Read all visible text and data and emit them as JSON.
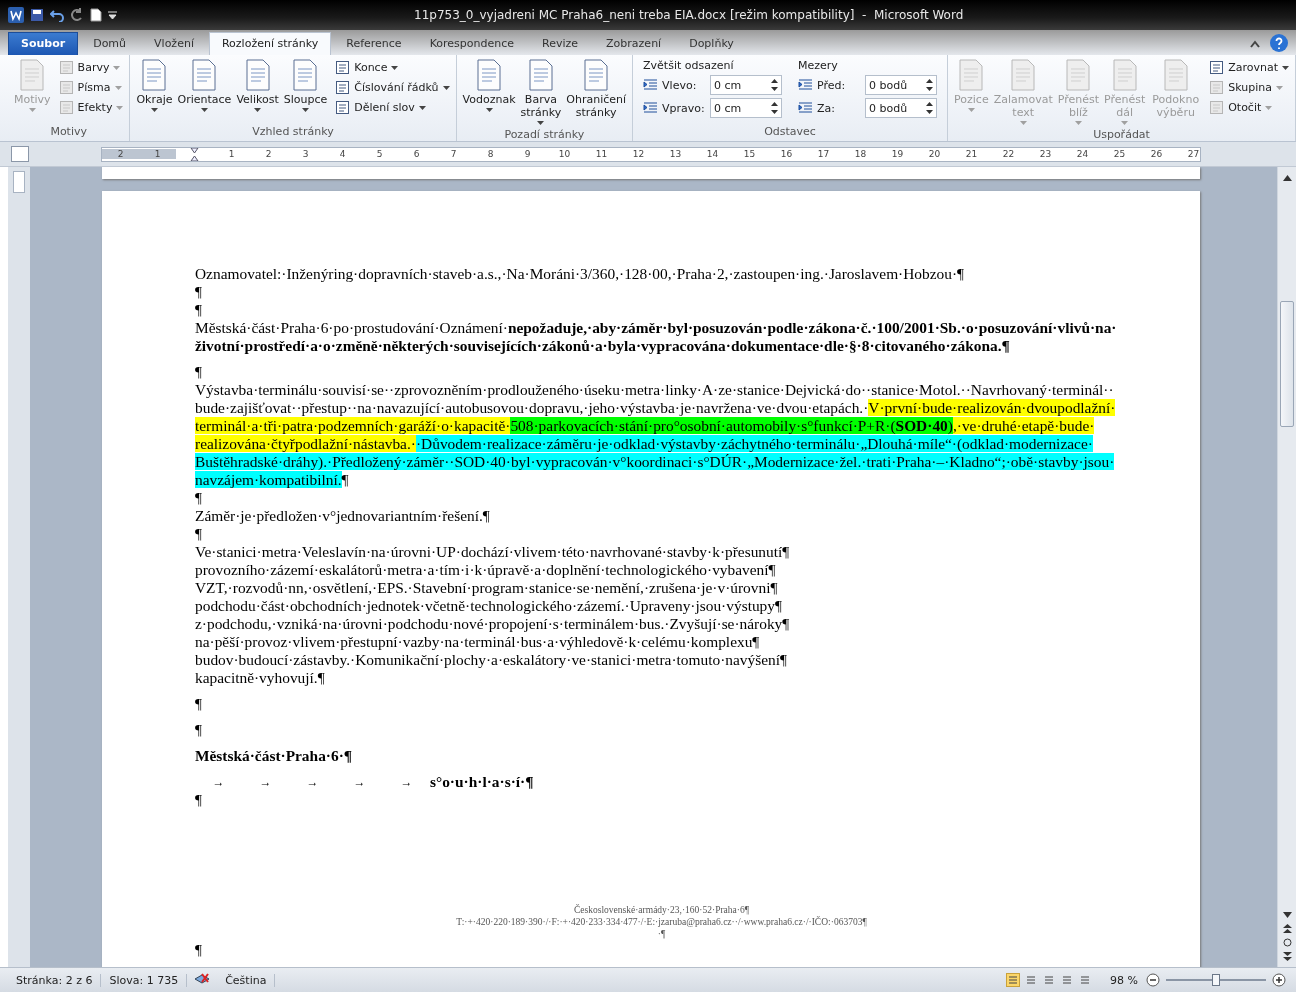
{
  "window": {
    "title": "11p753_0_vyjadreni MC Praha6_neni treba EIA.docx [režim kompatibility]  -  Microsoft Word"
  },
  "tabs": [
    {
      "label": "Soubor",
      "kind": "file",
      "selected": false
    },
    {
      "label": "Domů",
      "kind": "tab",
      "selected": false
    },
    {
      "label": "Vložení",
      "kind": "tab",
      "selected": false
    },
    {
      "label": "Rozložení stránky",
      "kind": "tab",
      "selected": true
    },
    {
      "label": "Reference",
      "kind": "tab",
      "selected": false
    },
    {
      "label": "Korespondence",
      "kind": "tab",
      "selected": false
    },
    {
      "label": "Revize",
      "kind": "tab",
      "selected": false
    },
    {
      "label": "Zobrazení",
      "kind": "tab",
      "selected": false
    },
    {
      "label": "Doplňky",
      "kind": "tab",
      "selected": false
    }
  ],
  "ribbon": [
    {
      "label": "Motivy",
      "sections": [
        {
          "kind": "big",
          "items": [
            {
              "label": "Motivy",
              "disabled": true,
              "dropdown": true
            }
          ]
        },
        {
          "kind": "stack",
          "items": [
            {
              "label": "Barvy",
              "disabled": true,
              "dropdown": true
            },
            {
              "label": "Písma",
              "disabled": true,
              "dropdown": true
            },
            {
              "label": "Efekty",
              "disabled": true,
              "dropdown": true
            }
          ]
        }
      ]
    },
    {
      "label": "Vzhled stránky",
      "sections": [
        {
          "kind": "big",
          "items": [
            {
              "label": "Okraje",
              "disabled": false,
              "dropdown": true
            },
            {
              "label": "Orientace",
              "disabled": false,
              "dropdown": true
            },
            {
              "label": "Velikost",
              "disabled": false,
              "dropdown": true
            },
            {
              "label": "Sloupce",
              "disabled": false,
              "dropdown": true
            }
          ]
        },
        {
          "kind": "stack",
          "items": [
            {
              "label": "Konce",
              "disabled": false,
              "dropdown": true
            },
            {
              "label": "Číslování řádků",
              "disabled": false,
              "dropdown": true
            },
            {
              "label": "Dělení slov",
              "disabled": false,
              "dropdown": true
            }
          ]
        }
      ]
    },
    {
      "label": "Pozadí stránky",
      "sections": [
        {
          "kind": "big",
          "items": [
            {
              "label": "Vodoznak",
              "disabled": false,
              "dropdown": true
            },
            {
              "label": "Barva stránky",
              "disabled": false,
              "dropdown": true
            },
            {
              "label": "Ohraničení stránky",
              "disabled": false,
              "dropdown": false
            }
          ]
        }
      ]
    },
    {
      "label": "Odstavec",
      "sections": [
        {
          "kind": "fields",
          "title": "Zvětšit odsazení",
          "rows": [
            {
              "label": "Vlevo:",
              "value": "0 cm"
            },
            {
              "label": "Vpravo:",
              "value": "0 cm"
            }
          ]
        },
        {
          "kind": "fields",
          "title": "Mezery",
          "rows": [
            {
              "label": "Před:",
              "value": "0 bodů"
            },
            {
              "label": "Za:",
              "value": "0 bodů"
            }
          ]
        }
      ]
    },
    {
      "label": "Uspořádat",
      "sections": [
        {
          "kind": "big",
          "items": [
            {
              "label": "Pozice",
              "disabled": true,
              "dropdown": true
            },
            {
              "label": "Zalamovat text",
              "disabled": true,
              "dropdown": true
            },
            {
              "label": "Přenést blíž",
              "disabled": true,
              "dropdown": true
            },
            {
              "label": "Přenést dál",
              "disabled": true,
              "dropdown": true
            },
            {
              "label": "Podokno výběru",
              "disabled": true,
              "dropdown": false
            }
          ]
        },
        {
          "kind": "stack",
          "items": [
            {
              "label": "Zarovnat",
              "disabled": false,
              "dropdown": true
            },
            {
              "label": "Skupina",
              "disabled": true,
              "dropdown": true
            },
            {
              "label": "Otočit",
              "disabled": true,
              "dropdown": true
            }
          ]
        }
      ]
    }
  ],
  "ruler": {
    "left_labels": [
      "2",
      "1"
    ],
    "labels": [
      "1",
      "2",
      "3",
      "4",
      "5",
      "6",
      "7",
      "8",
      "9",
      "10",
      "11",
      "12",
      "13",
      "14",
      "15",
      "16",
      "17",
      "18",
      "19",
      "20",
      "21",
      "22",
      "23",
      "24",
      "25",
      "26",
      "27"
    ]
  },
  "document": [
    {
      "kind": "para",
      "runs": [
        {
          "text": "Oznamovatel:·Inženýring·dopravních·staveb·a.s.,·Na·Moráni·3/360,·128·00,·Praha·2,·zastoupen·ing.·Jaroslavem·Hobzou·¶"
        }
      ]
    },
    {
      "kind": "para",
      "runs": [
        {
          "text": "¶"
        }
      ]
    },
    {
      "kind": "para",
      "runs": [
        {
          "text": "¶"
        }
      ]
    },
    {
      "kind": "para",
      "runs": [
        {
          "text": "Městská·část·Praha·6·po·prostudování·Oznámení·**nepožaduje,·aby·záměr·byl·posuzován·podle·zákona·č.·100/2001·Sb.·o·posuzování·vlivů·na·životní·prostředí·a·o·změně·některých·souvisejících·zákonů·a·byla·vypracována·dokumentace·dle·§·8·citovaného·zákona.¶**"
        }
      ]
    },
    {
      "kind": "spaced",
      "runs": [
        {
          "text": "¶"
        }
      ]
    },
    {
      "kind": "para",
      "runs": [
        {
          "text": "Výstavba·terminálu·souvisí·se··zprovozněním·prodlouženého·úseku·metra·linky·A·ze·stanice·Dejvická·do··stanice·Motol.··Navrhovaný·terminál··bude·zajišťovat··přestup··na·navazující·autobusovou·dopravu,·jeho·výstavba·je·navržena·ve·dvou·etapách.·"
        },
        {
          "text": "V·první·bude·realizován·dvoupodlažní·terminál·a·tři·patra·podzemních·garáží·o·kapacitě·",
          "color": "#ffff00"
        },
        {
          "text": "508·parkovacích·stání·pro°osobní·automobily·s°funkcí·P+R·(**SOD·40**)",
          "color": "#00ff00"
        },
        {
          "text": ",·ve·druhé·etapě·bude·",
          "color": "#ffff00"
        },
        {
          "text": "realizována·čtyřpodlažní·nástavba.·",
          "color": "#ffff00"
        },
        {
          "text": "·Důvodem·realizace·záměru·je·odklad·výstavby·záchytného·terminálu·„Dlouhá·míle“·(odklad·modernizace·Buštěhradské·dráhy).·Předložený·záměr··SOD·40·byl·vypracován·v°koordinaci·s°DÚR·„Modernizace·žel.·trati·Praha·–·Kladno“;·obě·stavby·jsou·navzájem·kompatibilní.",
          "color": "#00ffff"
        },
        {
          "text": "¶"
        }
      ]
    },
    {
      "kind": "para",
      "runs": [
        {
          "text": "¶"
        }
      ]
    },
    {
      "kind": "para",
      "runs": [
        {
          "text": "Záměr·je·předložen·v°jednovariantním·řešení.¶"
        }
      ]
    },
    {
      "kind": "para",
      "runs": [
        {
          "text": "¶"
        }
      ]
    },
    {
      "kind": "line",
      "runs": [
        {
          "text": "Ve·stanici·metra·Veleslavín·na·úrovni·UP·dochází·vlivem·této·navrhované·stavby·k·přesunutí¶"
        }
      ]
    },
    {
      "kind": "line",
      "runs": [
        {
          "text": "provozního·zázemí·eskalátorů·metra·a·tím·i·k·úpravě·a·doplnění·technologického·vybavení¶"
        }
      ]
    },
    {
      "kind": "line",
      "runs": [
        {
          "text": "VZT,·rozvodů·nn,·osvětlení,·EPS.·Stavební·program·stanice·se·nemění,·zrušena·je·v·úrovni¶"
        }
      ]
    },
    {
      "kind": "line",
      "runs": [
        {
          "text": "podchodu·část·obchodních·jednotek·včetně·technologického·zázemí.·Upraveny·jsou·výstupy¶"
        }
      ]
    },
    {
      "kind": "line",
      "runs": [
        {
          "text": "z·podchodu,·vzniká·na·úrovni·podchodu·nové·propojení·s·terminálem·bus.·Zvyšují·se·nároky¶"
        }
      ]
    },
    {
      "kind": "line",
      "runs": [
        {
          "text": "na·pěší·provoz·vlivem·přestupní·vazby·na·terminál·bus·a·výhledově·k·celému·komplexu¶"
        }
      ]
    },
    {
      "kind": "line",
      "runs": [
        {
          "text": "budov·budoucí·zástavby.·Komunikační·plochy·a·eskalátory·ve·stanici·metra·tomuto·navýšení¶"
        }
      ]
    },
    {
      "kind": "line",
      "runs": [
        {
          "text": "kapacitně·vyhovují.¶"
        }
      ]
    },
    {
      "kind": "spaced",
      "runs": [
        {
          "text": "¶"
        }
      ]
    },
    {
      "kind": "spaced",
      "runs": [
        {
          "text": "¶"
        }
      ]
    },
    {
      "kind": "heading",
      "runs": [
        {
          "text": "Městská·část·Praha·6·¶"
        }
      ]
    },
    {
      "kind": "tabbed",
      "tabs": [
        "→",
        "→",
        "→",
        "→",
        "→"
      ],
      "runs": [
        {
          "text": "s°o·u·h·l·a·s·í·¶"
        }
      ]
    },
    {
      "kind": "para",
      "runs": [
        {
          "text": "¶"
        }
      ]
    }
  ],
  "footer": [
    "Československé·armády·23,·160·52·Praha·6¶",
    "T:·+·420·220·189·390·/·F:·+·420·233·334·477·/·E:·jzaruba@praha6.cz··/·www.praha6.cz·/·IČO:·063703¶",
    "·¶"
  ],
  "next_paragraph": "¶",
  "status_bar": {
    "page": "Stránka: 2 z 6",
    "words": "Slova: 1 735",
    "language": "Čeština",
    "zoom": "98 %",
    "zoom_slider": {
      "level": 0.5
    }
  }
}
